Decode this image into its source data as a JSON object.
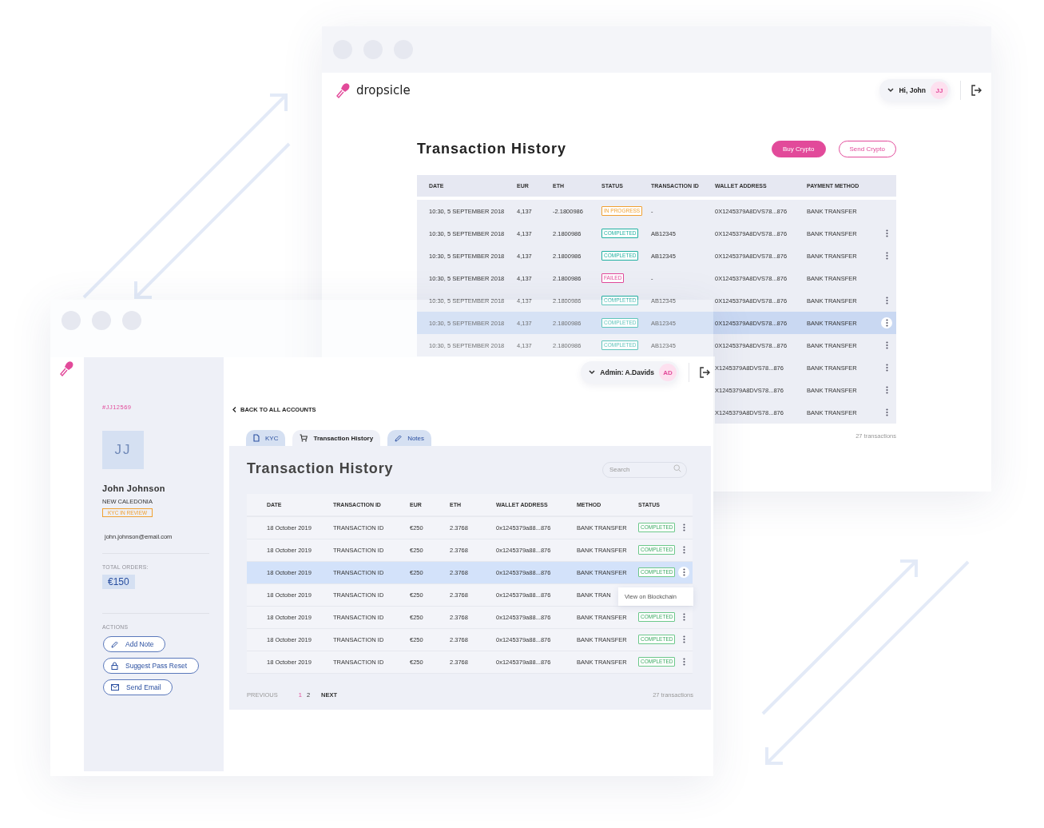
{
  "back_window": {
    "brand": "dropsicle",
    "user_menu": {
      "label": "Hi, John",
      "initials": "JJ"
    },
    "title": "Transaction History",
    "actions": [
      {
        "label": "Buy Crypto",
        "kind": "primary"
      },
      {
        "label": "Send Crypto",
        "kind": "secondary"
      }
    ],
    "table": {
      "columns": [
        "DATE",
        "EUR",
        "ETH",
        "STATUS",
        "TRANSACTION ID",
        "WALLET ADDRESS",
        "PAYMENT METHOD"
      ],
      "rows": [
        {
          "date": "10:30, 5 SEPTEMBER 2018",
          "eur": "4,137",
          "eth": "-2.1800986",
          "status": {
            "label": "IN PROGRESS",
            "kind": "pending"
          },
          "transaction_id": "-",
          "wallet_address": "0X1245379A8DVS78...876",
          "payment_method": "BANK TRANSFER",
          "menu": false,
          "selected": false
        },
        {
          "date": "10:30, 5 SEPTEMBER 2018",
          "eur": "4,137",
          "eth": "2.1800986",
          "status": {
            "label": "COMPLETED",
            "kind": "success"
          },
          "transaction_id": "AB12345",
          "wallet_address": "0X1245379A8DVS78...876",
          "payment_method": "BANK TRANSFER",
          "menu": true,
          "selected": false
        },
        {
          "date": "10:30, 5 SEPTEMBER 2018",
          "eur": "4,137",
          "eth": "2.1800986",
          "status": {
            "label": "COMPLETED",
            "kind": "success"
          },
          "transaction_id": "AB12345",
          "wallet_address": "0X1245379A8DVS78...876",
          "payment_method": "BANK TRANSFER",
          "menu": true,
          "selected": false
        },
        {
          "date": "10:30, 5 SEPTEMBER 2018",
          "eur": "4,137",
          "eth": "2.1800986",
          "status": {
            "label": "FAILED",
            "kind": "failed"
          },
          "transaction_id": "-",
          "wallet_address": "0X1245379A8DVS78...876",
          "payment_method": "BANK TRANSFER",
          "menu": false,
          "selected": false
        },
        {
          "date": "10:30, 5 SEPTEMBER 2018",
          "eur": "4,137",
          "eth": "2.1800986",
          "status": {
            "label": "COMPLETED",
            "kind": "success"
          },
          "transaction_id": "AB12345",
          "wallet_address": "0X1245379A8DVS78...876",
          "payment_method": "BANK TRANSFER",
          "menu": true,
          "selected": false
        },
        {
          "date": "10:30, 5 SEPTEMBER 2018",
          "eur": "4,137",
          "eth": "2.1800986",
          "status": {
            "label": "COMPLETED",
            "kind": "success"
          },
          "transaction_id": "AB12345",
          "wallet_address": "0X1245379A8DVS78...876",
          "payment_method": "BANK TRANSFER",
          "menu": true,
          "selected": true
        },
        {
          "date": "10:30, 5 SEPTEMBER 2018",
          "eur": "4,137",
          "eth": "2.1800986",
          "status": {
            "label": "COMPLETED",
            "kind": "success"
          },
          "transaction_id": "AB12345",
          "wallet_address": "0X1245379A8DVS78...876",
          "payment_method": "BANK TRANSFER",
          "menu": true,
          "selected": false
        },
        {
          "wallet_address": "X1245379A8DVS78...876",
          "payment_method": "BANK TRANSFER",
          "menu": true,
          "selected": false
        },
        {
          "wallet_address": "X1245379A8DVS78...876",
          "payment_method": "BANK TRANSFER",
          "menu": true,
          "selected": false
        },
        {
          "wallet_address": "X1245379A8DVS78...876",
          "payment_method": "BANK TRANSFER",
          "menu": true,
          "selected": false
        }
      ]
    },
    "footer": "27 transactions"
  },
  "front_window": {
    "user_menu": {
      "label": "Admin: A.Davids",
      "initials": "AD"
    },
    "profile": {
      "account_id": "#JJ12569",
      "initials": "JJ",
      "name": "John Johnson",
      "location": "NEW CALEDONIA",
      "kyc_badge": "KYC IN REVIEW",
      "email": "john.johnson@email.com",
      "total_orders_label": "TOTAL ORDERS:",
      "total_orders": "€150",
      "actions_label": "ACTIONS",
      "actions": [
        {
          "label": "Add Note",
          "kind": "note"
        },
        {
          "label": "Suggest Pass Reset",
          "kind": "password"
        },
        {
          "label": "Send Email",
          "kind": "email"
        }
      ]
    },
    "back_link": "BACK TO ALL ACCOUNTS",
    "tabs": [
      {
        "label": "KYC",
        "kind": "document",
        "selected": false
      },
      {
        "label": "Transaction History",
        "kind": "cart",
        "selected": true
      },
      {
        "label": "Notes",
        "kind": "note",
        "selected": false
      }
    ],
    "panel": {
      "title": "Transaction History",
      "search": {
        "placeholder": "Search"
      },
      "table": {
        "columns": [
          "DATE",
          "TRANSACTION ID",
          "EUR",
          "ETH",
          "WALLET ADDRESS",
          "METHOD",
          "STATUS"
        ],
        "rows": [
          {
            "date": "18 October 2019",
            "transaction_id": "TRANSACTION ID",
            "eur": "€250",
            "eth": "2.3768",
            "wallet_address": "0x1245379a88...876",
            "method": "BANK TRANSFER",
            "status": {
              "label": "COMPLETED",
              "kind": "success"
            },
            "selected": false
          },
          {
            "date": "18 October 2019",
            "transaction_id": "TRANSACTION ID",
            "eur": "€250",
            "eth": "2.3768",
            "wallet_address": "0x1245379a88...876",
            "method": "BANK TRANSFER",
            "status": {
              "label": "COMPLETED",
              "kind": "success"
            },
            "selected": false
          },
          {
            "date": "18 October 2019",
            "transaction_id": "TRANSACTION ID",
            "eur": "€250",
            "eth": "2.3768",
            "wallet_address": "0x1245379a88...876",
            "method": "BANK TRANSFER",
            "status": {
              "label": "COMPLETED",
              "kind": "success"
            },
            "selected": true
          },
          {
            "date": "18 October 2019",
            "transaction_id": "TRANSACTION ID",
            "eur": "€250",
            "eth": "2.3768",
            "wallet_address": "0x1245379a88...876",
            "method": "BANK TRAN",
            "selected": false
          },
          {
            "date": "18 October 2019",
            "transaction_id": "TRANSACTION ID",
            "eur": "€250",
            "eth": "2.3768",
            "wallet_address": "0x1245379a88...876",
            "method": "BANK TRANSFER",
            "status": {
              "label": "COMPLETED",
              "kind": "success"
            },
            "selected": false
          },
          {
            "date": "18 October 2019",
            "transaction_id": "TRANSACTION ID",
            "eur": "€250",
            "eth": "2.3768",
            "wallet_address": "0x1245379a88...876",
            "method": "BANK TRANSFER",
            "status": {
              "label": "COMPLETED",
              "kind": "success"
            },
            "selected": false
          },
          {
            "date": "18 October 2019",
            "transaction_id": "TRANSACTION ID",
            "eur": "€250",
            "eth": "2.3768",
            "wallet_address": "0x1245379a88...876",
            "method": "BANK TRANSFER",
            "status": {
              "label": "COMPLETED",
              "kind": "success"
            },
            "selected": false
          }
        ]
      },
      "context_menu": {
        "items": [
          "View on Blockchain"
        ]
      },
      "pagination": {
        "previous": {
          "label": "PREVIOUS",
          "disabled": true
        },
        "pages": [
          {
            "label": "1",
            "selected": true
          },
          {
            "label": "2",
            "selected": false
          }
        ],
        "next": {
          "label": "NEXT",
          "disabled": false
        }
      },
      "footer": "27 transactions"
    }
  }
}
